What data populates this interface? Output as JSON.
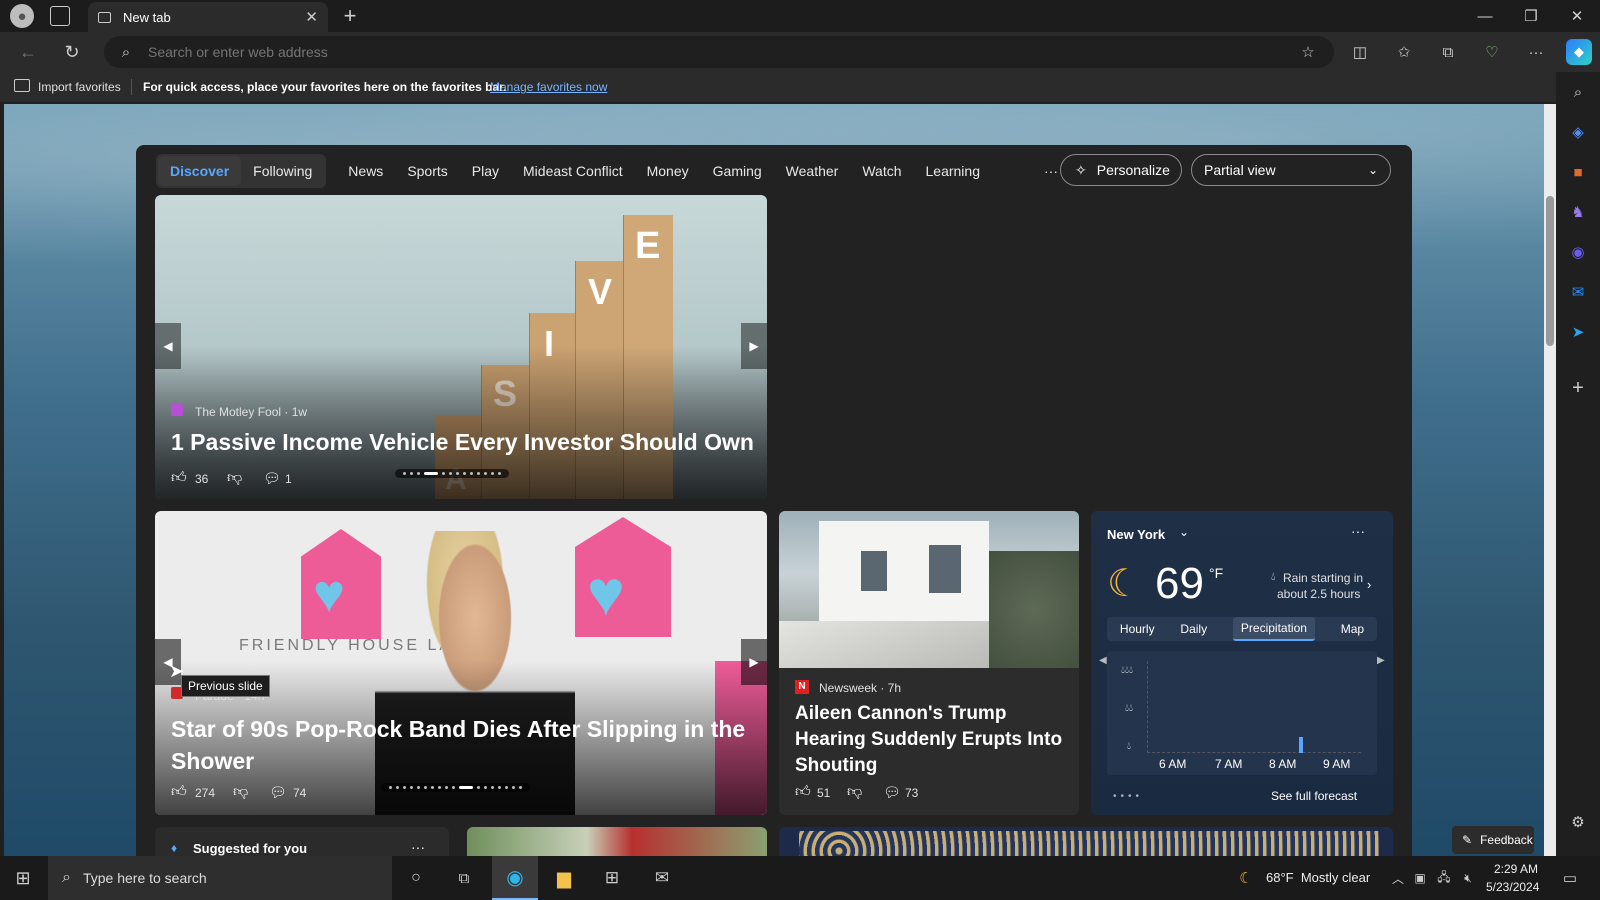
{
  "browser": {
    "tab_title": "New tab",
    "address_placeholder": "Search or enter web address",
    "favorites": {
      "import_label": "Import favorites",
      "message": "For quick access, place your favorites here on the favorites bar.",
      "manage_link": "Manage favorites now"
    }
  },
  "nav": {
    "tabs": [
      "Discover",
      "Following"
    ],
    "items": [
      "News",
      "Sports",
      "Play",
      "Mideast Conflict",
      "Money",
      "Gaming",
      "Weather",
      "Watch",
      "Learning"
    ],
    "more": "···",
    "personalize": "Personalize",
    "view_select": "Partial view"
  },
  "hero": {
    "source": "The Motley Fool · 1w",
    "headline": "1 Passive Income Vehicle Every Investor Should Own",
    "likes": "36",
    "comments": "1",
    "blocks": [
      "E",
      "V",
      "I",
      "S",
      "A"
    ]
  },
  "story2": {
    "source": "Parade · 14h",
    "tooltip": "Previous slide",
    "headline": "Star of 90s Pop-Rock Band Dies After Slipping in the Shower",
    "likes": "274",
    "comments": "74",
    "banner_text": "FRIENDLY HOUSE LA"
  },
  "story3": {
    "source": "Newsweek · 7h",
    "source_logo": "N",
    "headline": "Aileen Cannon's Trump Hearing Suddenly Erupts Into Shouting",
    "likes": "51",
    "comments": "73"
  },
  "weather": {
    "city": "New York",
    "temp": "69",
    "unit": "°F",
    "note_line1": "Rain starting in",
    "note_line2": "about 2.5 hours",
    "tabs": [
      "Hourly",
      "Daily",
      "Precipitation",
      "Map"
    ],
    "times": [
      "6 AM",
      "7 AM",
      "8 AM",
      "9 AM"
    ],
    "see_forecast": "See full forecast"
  },
  "bottom": {
    "suggested": "Suggested for you",
    "feedback": "Feedback"
  },
  "taskbar": {
    "search_placeholder": "Type here to search",
    "weather": "68°F  Mostly clear",
    "time": "2:29 AM",
    "date": "5/23/2024"
  }
}
